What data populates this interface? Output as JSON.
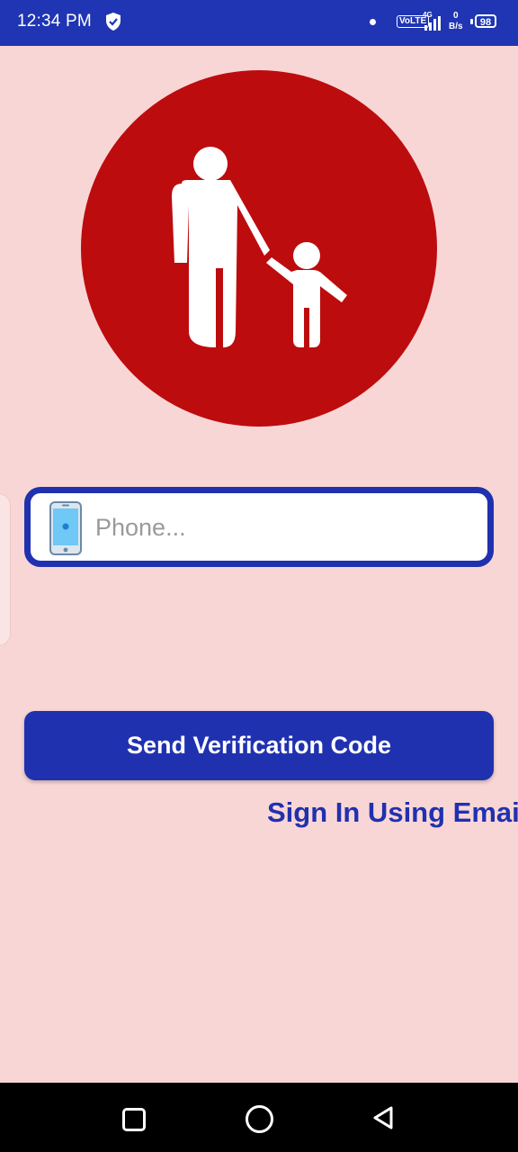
{
  "status_bar": {
    "time": "12:34 PM",
    "volte": "VoLTE",
    "network": "4G",
    "data_rate_value": "0",
    "data_rate_unit": "B/s",
    "battery": "98",
    "icons": [
      "shield-icon",
      "notification-dot-icon",
      "signal-icon",
      "battery-icon"
    ]
  },
  "logo": {
    "icon": "parent-child-icon",
    "background": "#bd0c0e"
  },
  "phone": {
    "placeholder": "Phone...",
    "value": "",
    "icon": "mobile-phone-icon"
  },
  "send_button": {
    "label": "Send Verification Code"
  },
  "email_link": {
    "label": "Sign In Using Email"
  },
  "nav_bar": {
    "icons": [
      "recent-apps-icon",
      "home-icon",
      "back-icon"
    ]
  },
  "colors": {
    "primary": "#2031b0",
    "background": "#f9d6d6",
    "logo_red": "#bd0c0e"
  }
}
